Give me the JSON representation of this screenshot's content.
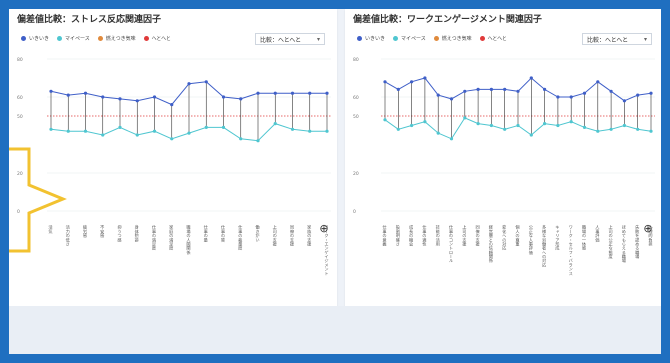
{
  "left_panel": {
    "title": "偏差値比較：ストレス反応関連因子",
    "select_label": "比較：へとへと",
    "legend": [
      {
        "label": "いきいき",
        "color": "#3f5fc8"
      },
      {
        "label": "マイペース",
        "color": "#4fc6d0"
      },
      {
        "label": "燃えつき気味",
        "color": "#e08a3c"
      },
      {
        "label": "へとへと",
        "color": "#e03a3a"
      }
    ],
    "yticks": [
      "80",
      "60",
      "50",
      "20",
      "0"
    ],
    "categories": [
      "活気",
      "活力の低さ",
      "疲労感",
      "不安感",
      "抑うつ感",
      "身体愁訴",
      "仕事の満足度",
      "家庭の満足度",
      "職場の人間関係",
      "仕事の量",
      "仕事の質",
      "仕事の裁量度",
      "働きがい",
      "上司の支援",
      "同僚の支援",
      "家族の支援",
      "ワーク・エンゲイジメント"
    ],
    "chart_data": {
      "type": "line",
      "series": [
        {
          "name": "いきいき",
          "values": [
            63,
            61,
            62,
            60,
            59,
            58,
            60,
            56,
            67,
            68,
            60,
            59,
            62,
            62,
            62,
            62,
            62
          ]
        },
        {
          "name": "マイペース",
          "values": [
            43,
            42,
            42,
            40,
            44,
            40,
            42,
            38,
            41,
            44,
            44,
            38,
            37,
            46,
            43,
            42,
            42
          ]
        }
      ],
      "ylim": [
        0,
        80
      ],
      "reference_line": 50
    }
  },
  "right_panel": {
    "title": "偏差値比較：ワークエンゲージメント関連因子",
    "select_label": "比較：へとへと",
    "legend": [
      {
        "label": "いきいき",
        "color": "#3f5fc8"
      },
      {
        "label": "マイペース",
        "color": "#4fc6d0"
      },
      {
        "label": "燃えつき気味",
        "color": "#e08a3c"
      },
      {
        "label": "へとへと",
        "color": "#e03a3a"
      }
    ],
    "yticks": [
      "80",
      "60",
      "50",
      "20",
      "0"
    ],
    "categories": [
      "仕事の意義",
      "役割明確さ",
      "成長の機会",
      "仕事の適性",
      "技能の活用",
      "仕事のコントロール",
      "上司の支援",
      "同僚の支援",
      "経営層との信頼関係",
      "変化への対応",
      "個人の尊重",
      "公正な人事評価",
      "多様な労働者への対応",
      "キャリア形成",
      "ワーク・セルフ・バランス",
      "職場の一体感",
      "人事評価",
      "上司の公正な態度",
      "ほめてもらえる職場",
      "失敗を認める職場",
      "心理的負担"
    ],
    "chart_data": {
      "type": "line",
      "series": [
        {
          "name": "いきいき",
          "values": [
            68,
            64,
            68,
            70,
            61,
            59,
            63,
            64,
            64,
            64,
            63,
            70,
            64,
            60,
            60,
            62,
            68,
            63,
            58,
            61,
            62
          ]
        },
        {
          "name": "マイペース",
          "values": [
            48,
            43,
            45,
            47,
            41,
            38,
            49,
            46,
            45,
            43,
            45,
            40,
            46,
            45,
            47,
            44,
            42,
            43,
            45,
            43,
            42
          ]
        }
      ],
      "ylim": [
        0,
        80
      ],
      "reference_line": 50
    }
  }
}
